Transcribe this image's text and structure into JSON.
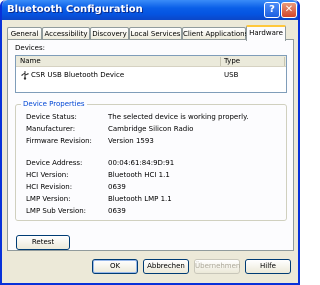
{
  "window": {
    "title": "Bluetooth Configuration",
    "help_glyph": "?",
    "close_glyph": "✕"
  },
  "tabs": [
    {
      "label": "General"
    },
    {
      "label": "Accessibility"
    },
    {
      "label": "Discovery"
    },
    {
      "label": "Local Services"
    },
    {
      "label": "Client Applications"
    },
    {
      "label": "Hardware",
      "active": true
    }
  ],
  "devices": {
    "label": "Devices:",
    "columns": [
      "Name",
      "Type"
    ],
    "rows": [
      {
        "name": "CSR USB Bluetooth Device",
        "type": "USB"
      }
    ]
  },
  "properties": {
    "title": "Device Properties",
    "items": [
      {
        "label": "Device Status:",
        "value": "The selected device is working properly."
      },
      {
        "label": "Manufacturer:",
        "value": "Cambridge Silicon Radio"
      },
      {
        "label": "Firmware Revision:",
        "value": "Version 1593"
      },
      {
        "label": "Device Address:",
        "value": "00:04:61:84:9D:91"
      },
      {
        "label": "HCI Version:",
        "value": "Bluetooth HCI 1.1"
      },
      {
        "label": "HCI Revision:",
        "value": "0639"
      },
      {
        "label": "LMP Version:",
        "value": "Bluetooth LMP 1.1"
      },
      {
        "label": "LMP Sub Version:",
        "value": "0639"
      }
    ]
  },
  "buttons": {
    "reset": "Retest",
    "ok": "OK",
    "cancel": "Abbrechen",
    "apply": "Übernehmen",
    "help": "Hilfe"
  },
  "colors": {
    "title_bar": "#0554e1",
    "group_title": "#0046d5",
    "active_tab_accent": "#ffc83c"
  }
}
